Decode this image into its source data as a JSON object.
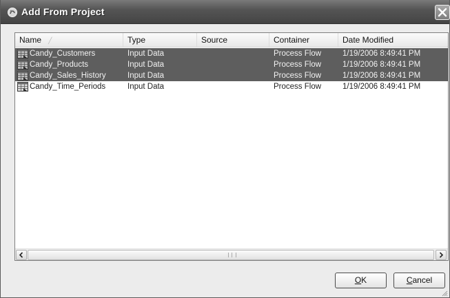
{
  "window": {
    "title": "Add From Project"
  },
  "listview": {
    "columns": [
      {
        "label": "Name",
        "sorted": true
      },
      {
        "label": "Type"
      },
      {
        "label": "Source"
      },
      {
        "label": "Container"
      },
      {
        "label": "Date Modified"
      }
    ],
    "rows": [
      {
        "name": "Candy_Customers",
        "type": "Input Data",
        "source": "",
        "container": "Process Flow",
        "date_modified": "1/19/2006 8:49:41 PM",
        "selected": true,
        "icon": "table-data-icon"
      },
      {
        "name": "Candy_Products",
        "type": "Input Data",
        "source": "",
        "container": "Process Flow",
        "date_modified": "1/19/2006 8:49:41 PM",
        "selected": true,
        "icon": "table-data-icon"
      },
      {
        "name": "Candy_Sales_History",
        "type": "Input Data",
        "source": "",
        "container": "Process Flow",
        "date_modified": "1/19/2006 8:49:41 PM",
        "selected": true,
        "icon": "table-data-icon"
      },
      {
        "name": "Candy_Time_Periods",
        "type": "Input Data",
        "source": "",
        "container": "Process Flow",
        "date_modified": "1/19/2006 8:49:41 PM",
        "selected": false,
        "icon": "table-data-icon"
      }
    ]
  },
  "buttons": {
    "ok_label_mnemonic": "O",
    "ok_label_rest": "K",
    "cancel_label_mnemonic": "C",
    "cancel_label_rest": "ancel"
  },
  "colors": {
    "titlebar": "#555555",
    "selection": "#5e5e5e",
    "dialog_bg": "#ececec"
  }
}
